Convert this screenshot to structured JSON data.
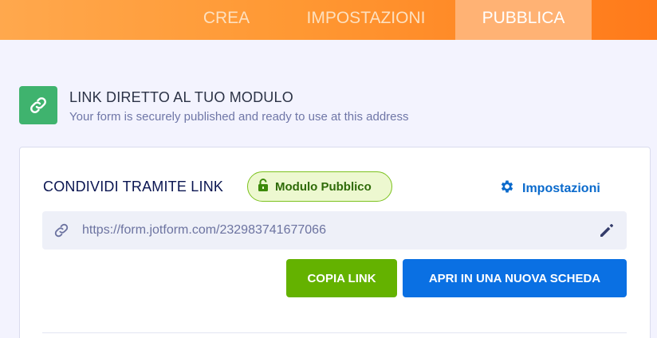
{
  "tabs": [
    {
      "label": "CREA",
      "active": false
    },
    {
      "label": "IMPOSTAZIONI",
      "active": false
    },
    {
      "label": "PUBBLICA",
      "active": true
    }
  ],
  "header": {
    "title": "LINK DIRETTO AL TUO MODULO",
    "subtitle": "Your form is securely published and ready to use at this address",
    "icon": "link-icon"
  },
  "share": {
    "title": "CONDIVIDI TRAMITE LINK",
    "badge_label": "Modulo Pubblico",
    "badge_icon": "unlock-icon",
    "settings_label": "Impostazioni",
    "settings_icon": "gear-icon",
    "url": "https://form.jotform.com/232983741677066",
    "url_icon": "link-icon",
    "edit_icon": "pencil-icon"
  },
  "buttons": {
    "copy_label": "COPIA LINK",
    "open_label": "APRI IN UNA NUOVA SCHEDA"
  },
  "colors": {
    "topbar_accent": "#ff9833",
    "header_icon_bg": "#3fb36e",
    "copy_button": "#64b200",
    "open_button": "#0a70e3",
    "settings_link": "#0a6acc"
  }
}
